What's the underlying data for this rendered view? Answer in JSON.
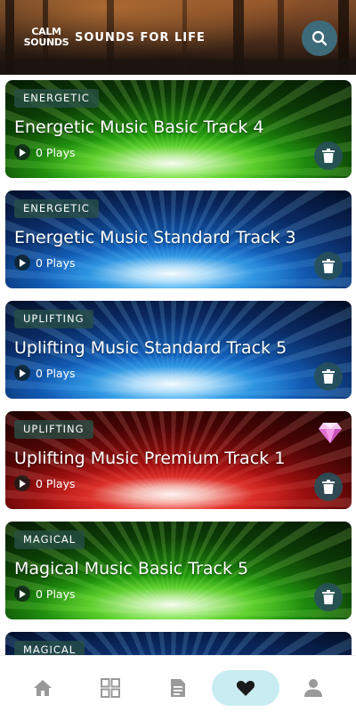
{
  "header": {
    "logo_line1": "CALM",
    "logo_line2": "SOUNDS",
    "title": "SOUNDS FOR LIFE",
    "search_icon": "search-icon"
  },
  "tracks": [
    {
      "category": "ENERGETIC",
      "title": "Energetic Music Basic Track 4",
      "plays": "0 Plays",
      "theme": "green",
      "premium": false
    },
    {
      "category": "ENERGETIC",
      "title": "Energetic Music Standard Track 3",
      "plays": "0 Plays",
      "theme": "blue",
      "premium": false
    },
    {
      "category": "UPLIFTING",
      "title": "Uplifting Music Standard Track 5",
      "plays": "0 Plays",
      "theme": "blue",
      "premium": false
    },
    {
      "category": "UPLIFTING",
      "title": "Uplifting Music Premium Track 1",
      "plays": "0 Plays",
      "theme": "red",
      "premium": true
    },
    {
      "category": "MAGICAL",
      "title": "Magical Music Basic Track 5",
      "plays": "0 Plays",
      "theme": "green",
      "premium": false
    },
    {
      "category": "MAGICAL",
      "title": "",
      "plays": "",
      "theme": "blue",
      "premium": false
    }
  ],
  "nav": {
    "items": [
      "home-icon",
      "grid-icon",
      "document-icon",
      "heart-icon",
      "profile-icon"
    ],
    "active": "heart-icon",
    "active_color": "#c8ecf2"
  },
  "colors": {
    "badge_bg": "#285046",
    "search_bg": "#3e6b7a",
    "nav_icon": "#9a9a9a"
  }
}
